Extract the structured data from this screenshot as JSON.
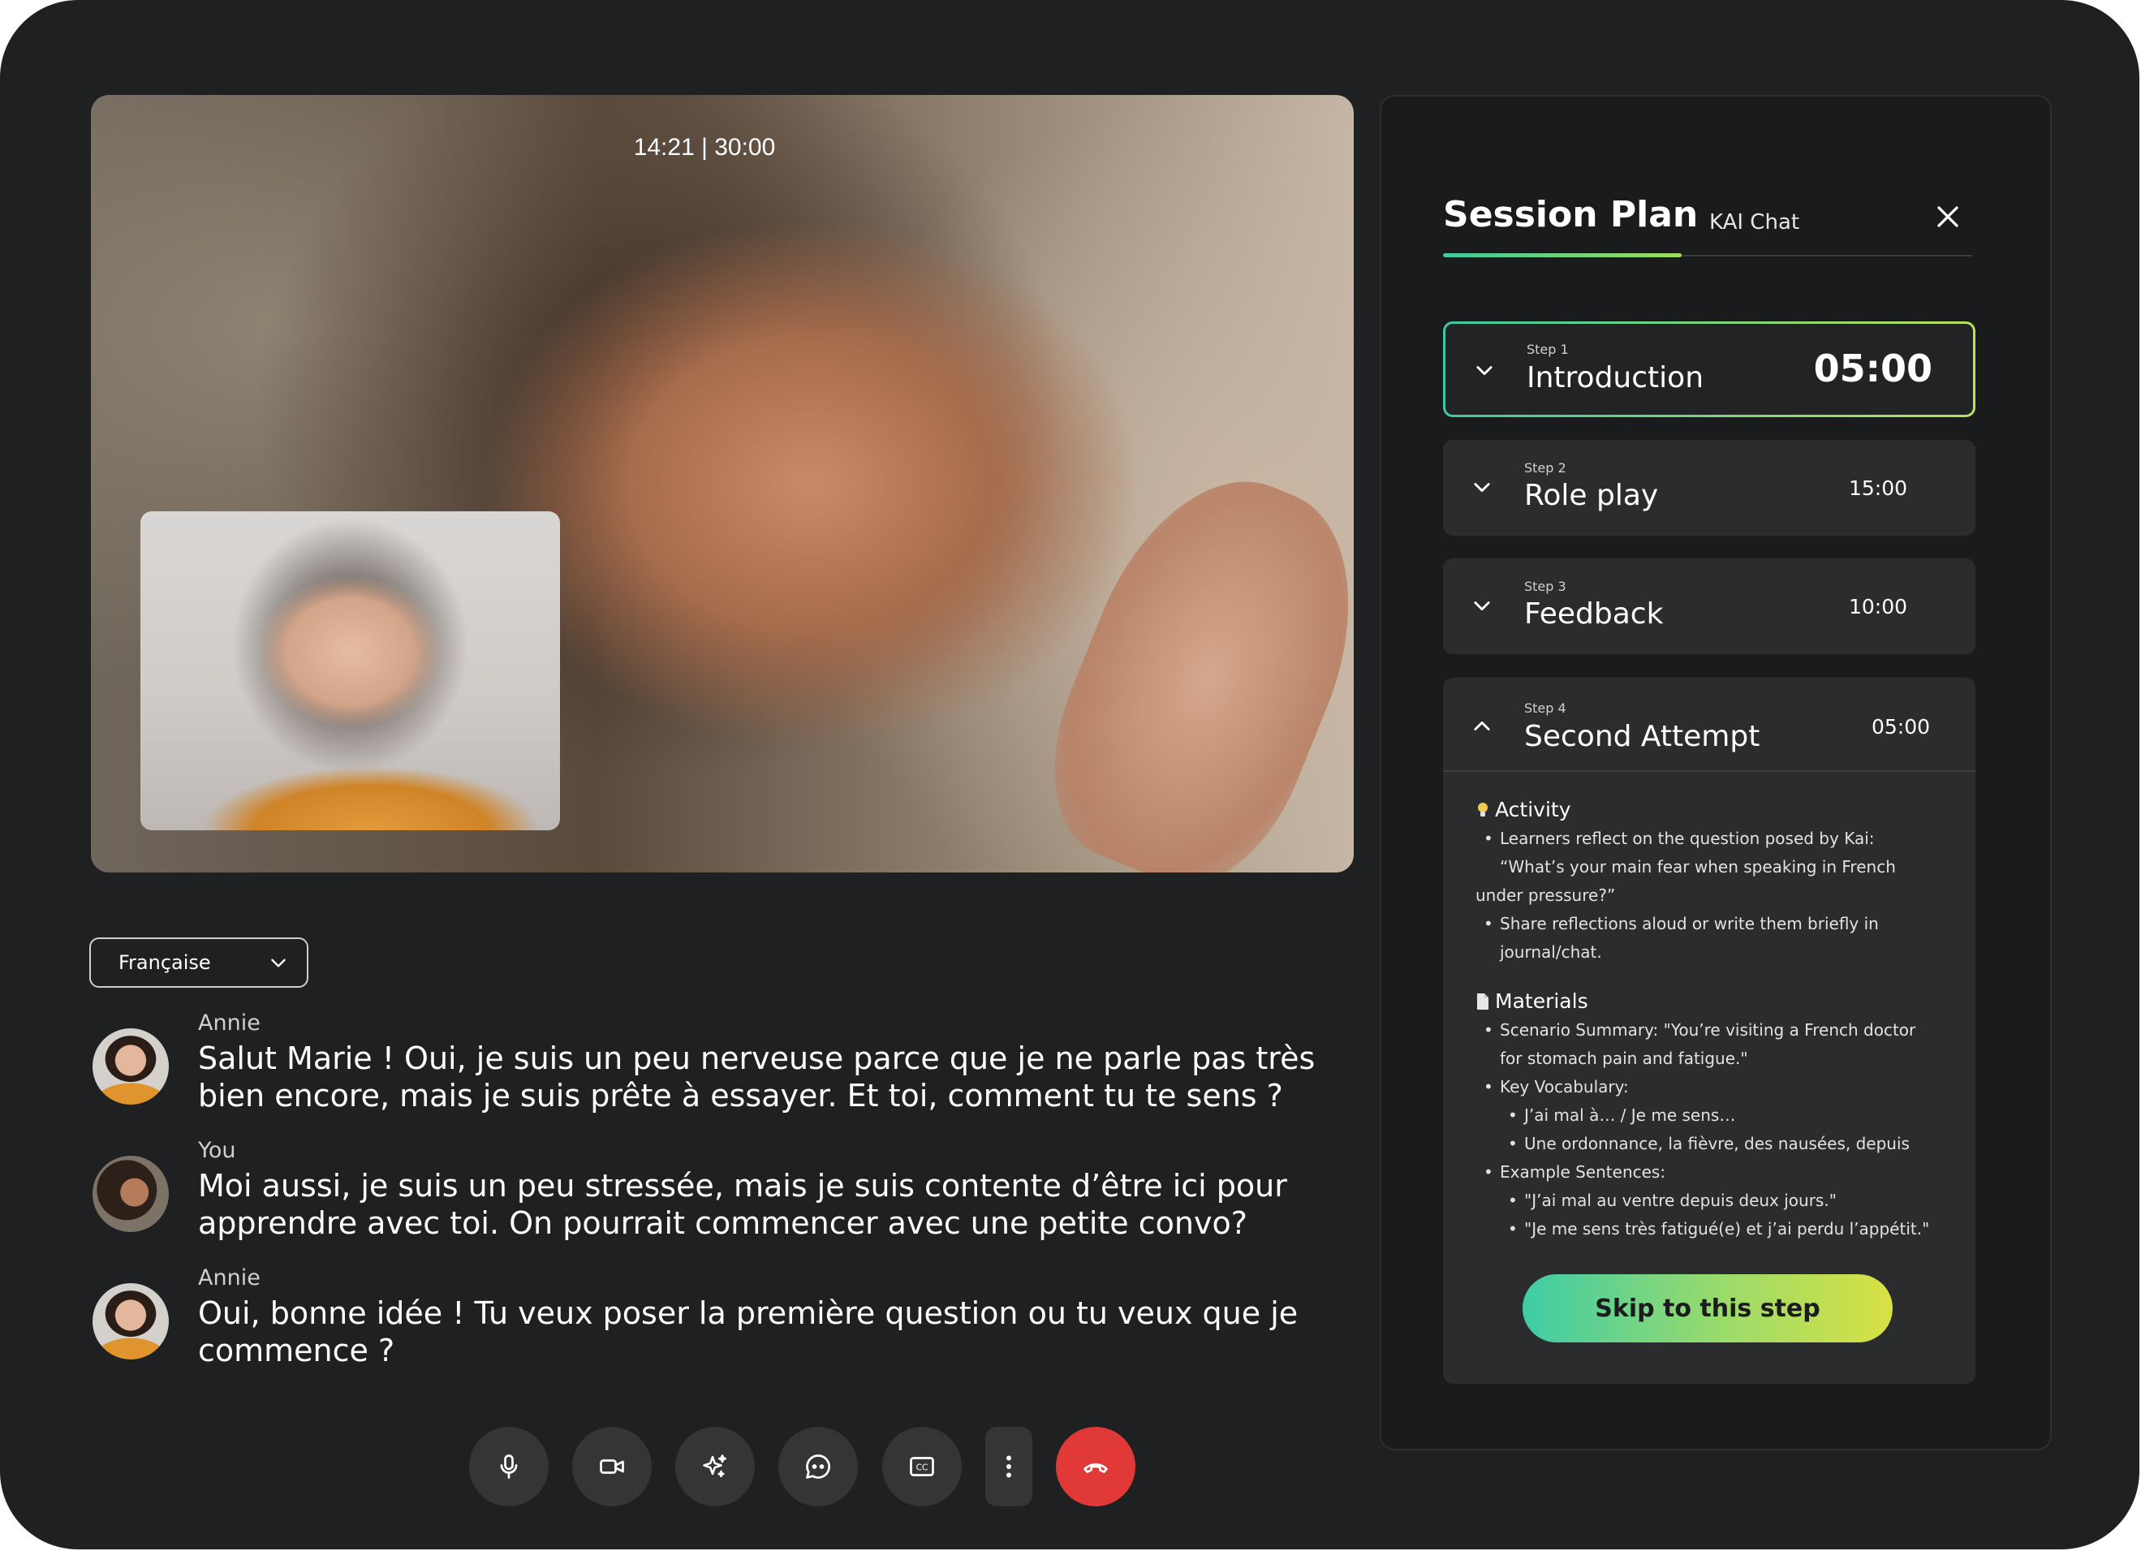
{
  "call": {
    "timer": "14:21 | 30:00",
    "language": "Française"
  },
  "transcript": [
    {
      "speaker": "Annie",
      "text": "Salut Marie ! Oui, je suis un peu nerveuse parce que je ne parle pas très bien encore, mais je suis prête à essayer. Et toi, comment tu te sens ?"
    },
    {
      "speaker": "You",
      "text": "Moi aussi, je suis un peu stressée, mais je suis contente d’être ici pour apprendre avec toi. On pourrait commencer avec une petite convo?"
    },
    {
      "speaker": "Annie",
      "text": "Oui, bonne idée ! Tu veux poser la première question ou tu veux que je commence ?"
    }
  ],
  "controls": {
    "icons": [
      "microphone-icon",
      "video-camera-icon",
      "sparkle-icon",
      "chat-bubble-icon",
      "closed-captions-icon",
      "more-vertical-icon",
      "end-call-icon"
    ],
    "end_color": "#e13838"
  },
  "panel": {
    "tabs": {
      "active": "Session Plan",
      "inactive": "KAI Chat"
    },
    "accent_gradient": [
      "#3fc9a0",
      "#d8e143"
    ],
    "steps": [
      {
        "num": "Step 1",
        "title": "Introduction",
        "duration": "05:00"
      },
      {
        "num": "Step 2",
        "title": "Role play",
        "duration": "15:00"
      },
      {
        "num": "Step 3",
        "title": "Feedback",
        "duration": "10:00"
      },
      {
        "num": "Step 4",
        "title": "Second Attempt",
        "duration": "05:00"
      }
    ],
    "activity": {
      "title": "Activity",
      "b1_a": "Learners reflect on the question posed by Kai:",
      "b1_b": "“What’s your main fear when speaking in French",
      "b1_c": "under pressure?”",
      "b2_a": "Share reflections aloud or write them briefly in",
      "b2_b": "journal/chat."
    },
    "materials": {
      "title": "Materials",
      "m1_a": "Scenario Summary: \"You’re visiting a French doctor",
      "m1_b": "for stomach pain and fatigue.\"",
      "m2": "Key Vocabulary:",
      "m2_1": "J’ai mal à… / Je me sens…",
      "m2_2": "Une ordonnance, la fièvre, des nausées, depuis",
      "m3": "Example Sentences:",
      "m3_1": "\"J’ai mal au ventre depuis deux jours.\"",
      "m3_2": "\"Je me sens très fatigué(e) et j’ai perdu l’appétit.\""
    },
    "skip_label": "Skip to this step"
  }
}
